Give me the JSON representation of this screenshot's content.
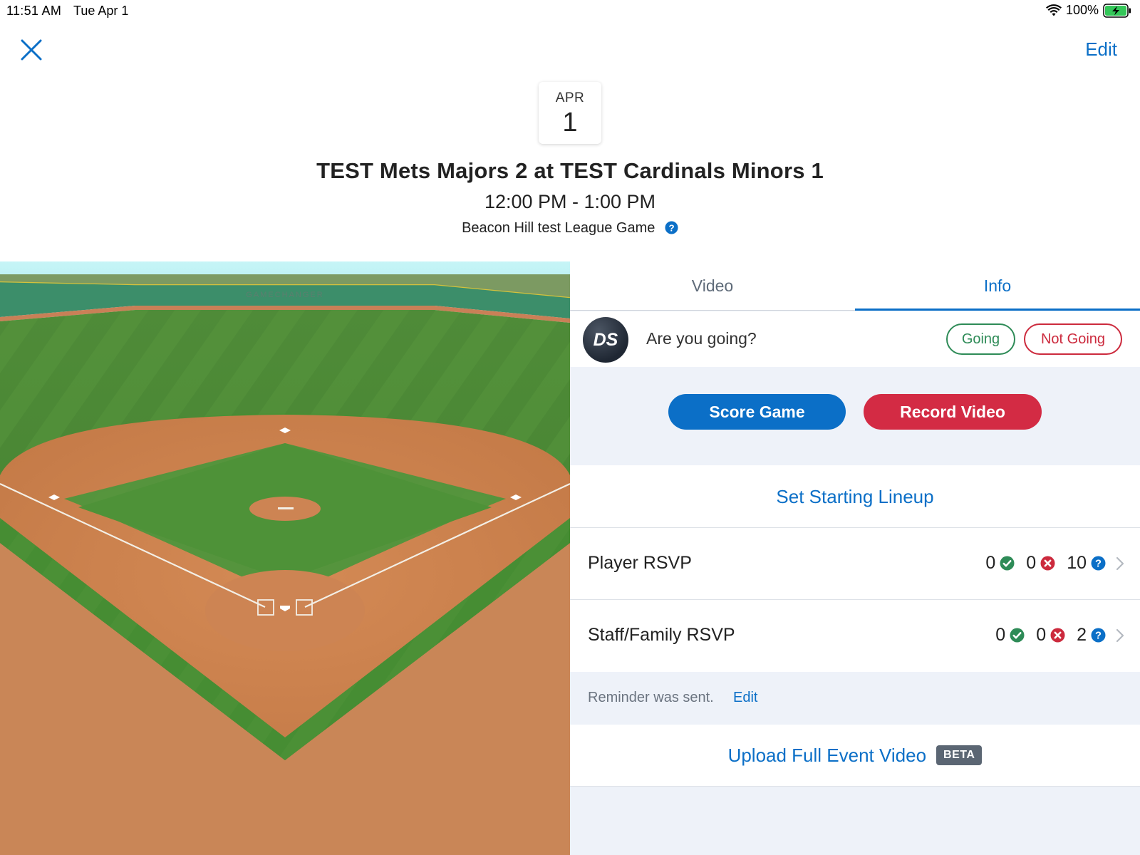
{
  "status_bar": {
    "time": "11:51 AM",
    "date": "Tue Apr 1",
    "battery_percent": "100%",
    "wifi_icon": "wifi-icon",
    "battery_icon": "battery-charging-icon"
  },
  "nav": {
    "close_icon": "close-icon",
    "edit_label": "Edit"
  },
  "event": {
    "month": "APR",
    "day": "1",
    "title": "TEST Mets Majors 2 at TEST Cardinals Minors 1",
    "time_range": "12:00 PM - 1:00 PM",
    "subtitle": "Beacon Hill test League Game",
    "help_icon": "question-circle-icon"
  },
  "field": {
    "banner_text": "GAMECHANGER"
  },
  "tabs": [
    {
      "label": "Video",
      "active": false
    },
    {
      "label": "Info",
      "active": true
    }
  ],
  "attendance": {
    "avatar_initials": "DS",
    "question": "Are you going?",
    "going_label": "Going",
    "not_going_label": "Not Going"
  },
  "actions": {
    "score_label": "Score Game",
    "record_label": "Record Video"
  },
  "lineup": {
    "label": "Set Starting Lineup"
  },
  "rsvp_rows": [
    {
      "label": "Player RSVP",
      "yes": "0",
      "no": "0",
      "unknown": "10"
    },
    {
      "label": "Staff/Family RSVP",
      "yes": "0",
      "no": "0",
      "unknown": "2"
    }
  ],
  "reminder": {
    "text": "Reminder was sent.",
    "edit_label": "Edit"
  },
  "upload": {
    "label": "Upload Full Event Video",
    "badge": "BETA"
  },
  "colors": {
    "accent_blue": "#0b6fc7",
    "record_red": "#d32b44",
    "going_green": "#2e8b57",
    "not_going_red": "#cc2a3d",
    "panel_bg": "#eef2f9"
  }
}
